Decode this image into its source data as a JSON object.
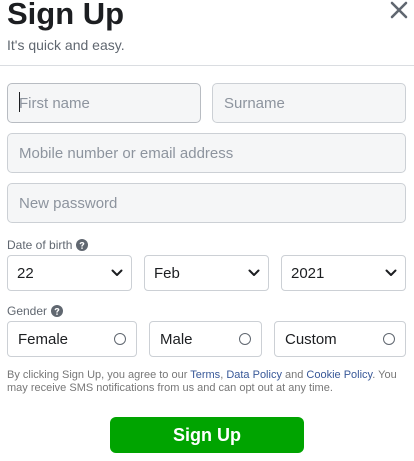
{
  "header": {
    "title": "Sign Up",
    "subtitle": "It's quick and easy."
  },
  "fields": {
    "first_name_placeholder": "First name",
    "surname_placeholder": "Surname",
    "mobile_email_placeholder": "Mobile number or email address",
    "new_password_placeholder": "New password"
  },
  "date_of_birth": {
    "label": "Date of birth",
    "day": "22",
    "month": "Feb",
    "year": "2021"
  },
  "gender": {
    "label": "Gender",
    "options": [
      "Female",
      "Male",
      "Custom"
    ]
  },
  "terms": {
    "prefix": "By clicking Sign Up, you agree to our ",
    "terms_link": "Terms",
    "comma": ", ",
    "data_policy_link": "Data Policy",
    "and": " and ",
    "cookie_policy_link": "Cookie Policy",
    "suffix": ". You may receive SMS notifications from us and can opt out at any time."
  },
  "signup_button": "Sign Up",
  "colors": {
    "primary_green": "#00a400",
    "link_blue": "#385898",
    "input_bg": "#f5f6f7"
  },
  "icons": {
    "close": "close-icon",
    "help": "question-mark-circle-icon",
    "dropdown": "chevron-down-icon"
  }
}
